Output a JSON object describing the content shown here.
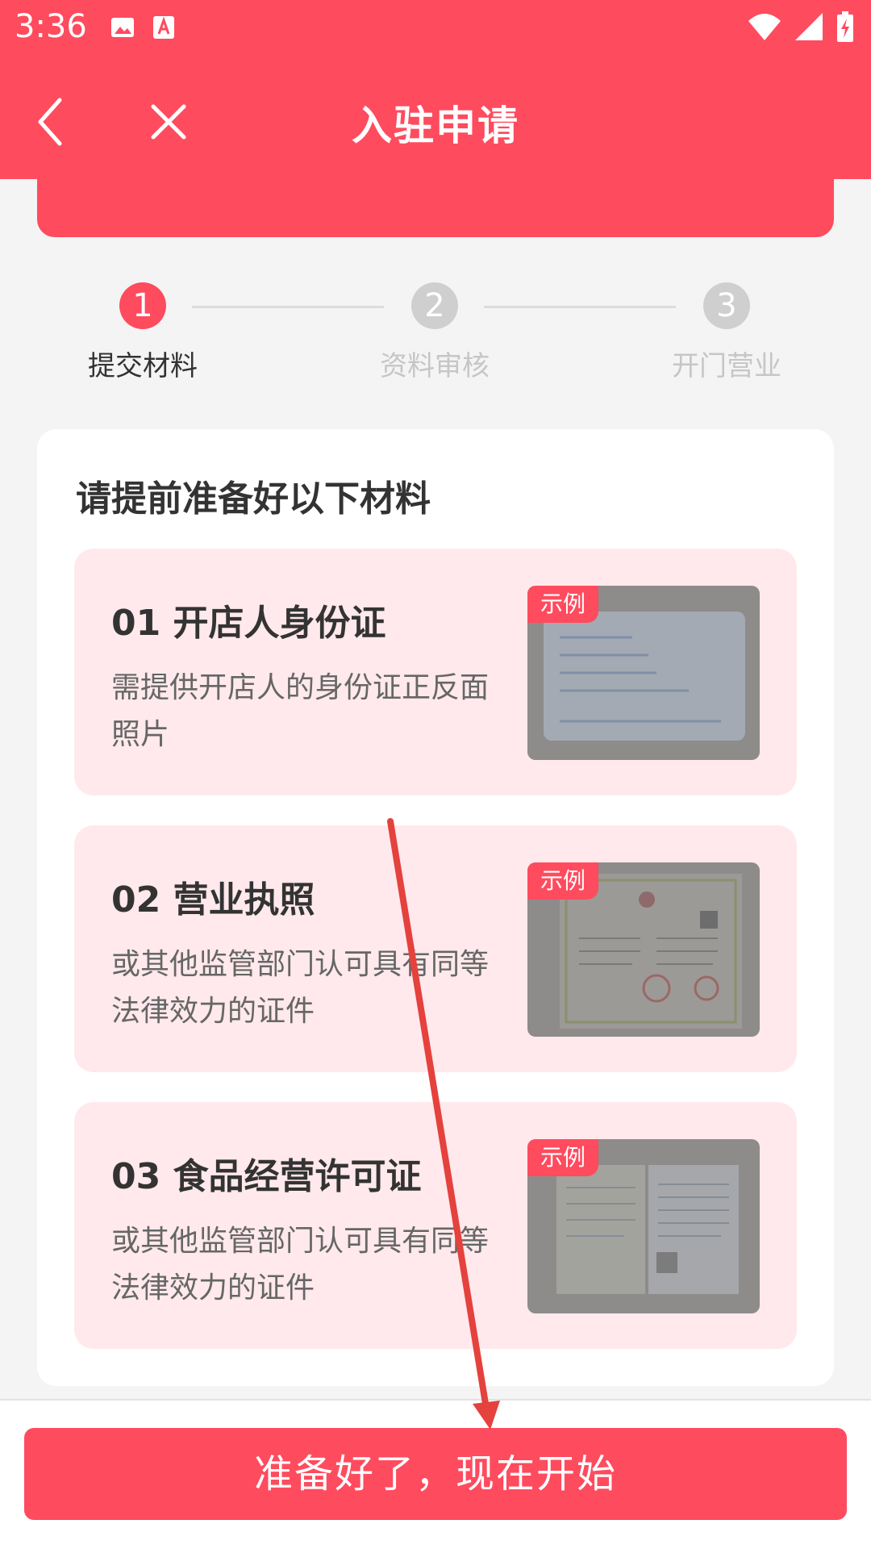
{
  "status_bar": {
    "time": "3:36"
  },
  "header": {
    "title": "入驻申请"
  },
  "stepper": {
    "steps": [
      {
        "number": "1",
        "label": "提交材料"
      },
      {
        "number": "2",
        "label": "资料审核"
      },
      {
        "number": "3",
        "label": "开门营业"
      }
    ]
  },
  "materials": {
    "title": "请提前准备好以下材料",
    "sample_tag": "示例",
    "items": [
      {
        "title": "01 开店人身份证",
        "desc": "需提供开店人的身份证正反面照片"
      },
      {
        "title": "02 营业执照",
        "desc": "或其他监管部门认可具有同等法律效力的证件"
      },
      {
        "title": "03 食品经营许可证",
        "desc": "或其他监管部门认可具有同等法律效力的证件"
      }
    ]
  },
  "footer": {
    "start_button": "准备好了，现在开始"
  },
  "colors": {
    "accent": "#ff4b5e",
    "card_bg": "#ffe9ec",
    "page_bg": "#f4f4f4"
  }
}
